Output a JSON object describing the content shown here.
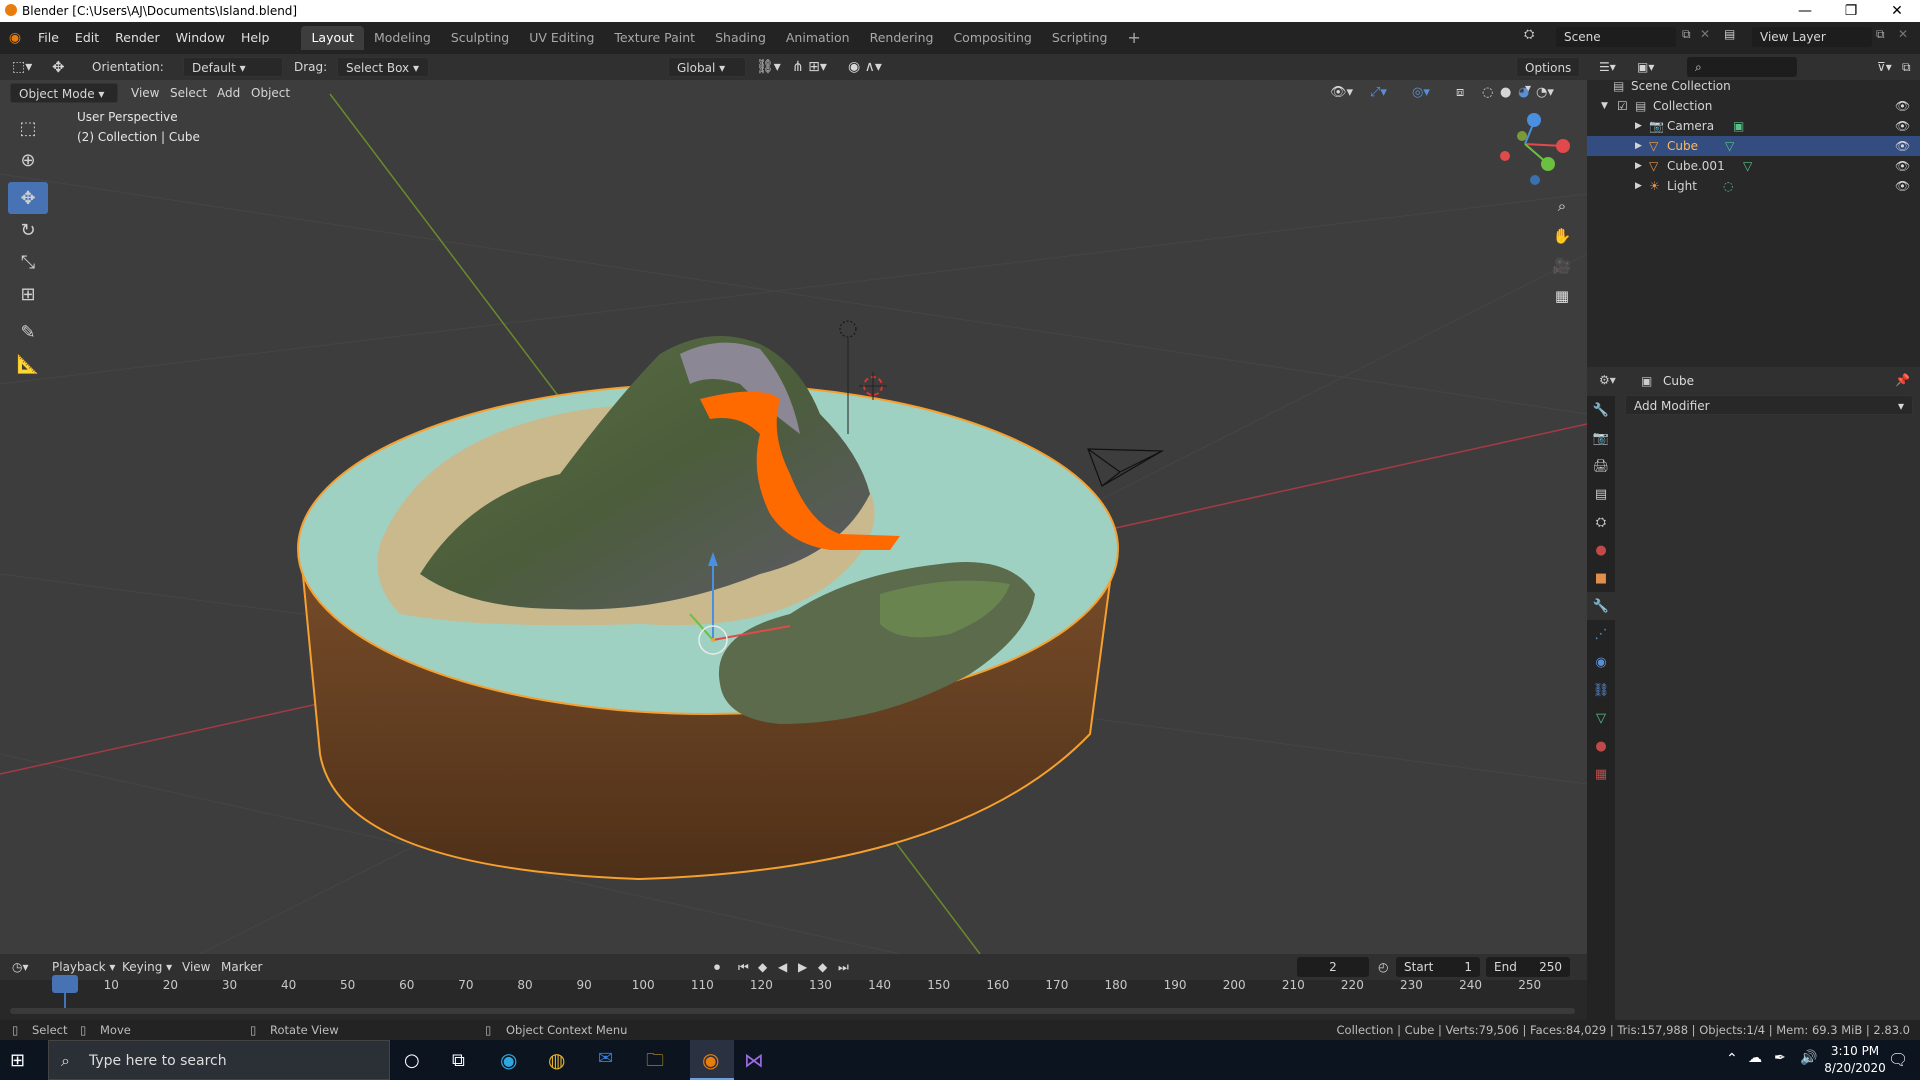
{
  "window": {
    "title": "Blender [C:\\Users\\AJ\\Documents\\Island.blend]"
  },
  "menus": [
    "File",
    "Edit",
    "Render",
    "Window",
    "Help"
  ],
  "workspaces": [
    "Layout",
    "Modeling",
    "Sculpting",
    "UV Editing",
    "Texture Paint",
    "Shading",
    "Animation",
    "Rendering",
    "Compositing",
    "Scripting"
  ],
  "active_workspace": "Layout",
  "scene": {
    "name": "Scene",
    "view_layer": "View Layer"
  },
  "tool_header": {
    "orientation_label": "Orientation:",
    "orientation_value": "Default",
    "drag_label": "Drag:",
    "drag_value": "Select Box",
    "transform_orientation": "Global",
    "options_label": "Options"
  },
  "viewport_header": {
    "mode": "Object Mode",
    "menu": [
      "View",
      "Select",
      "Add",
      "Object"
    ]
  },
  "viewport_overlay": {
    "perspective": "User Perspective",
    "collection_info": "(2) Collection | Cube"
  },
  "outliner": {
    "root": "Scene Collection",
    "collection": "Collection",
    "items": [
      {
        "name": "Camera",
        "selected": false
      },
      {
        "name": "Cube",
        "selected": true
      },
      {
        "name": "Cube.001",
        "selected": false
      },
      {
        "name": "Light",
        "selected": false
      }
    ]
  },
  "properties": {
    "object_name": "Cube",
    "add_modifier_label": "Add Modifier"
  },
  "timeline": {
    "menu": [
      "Playback",
      "Keying",
      "View",
      "Marker"
    ],
    "current_frame": "2",
    "start_label": "Start",
    "start_value": "1",
    "end_label": "End",
    "end_value": "250",
    "ticks": [
      "2",
      "10",
      "20",
      "30",
      "40",
      "50",
      "60",
      "70",
      "80",
      "90",
      "100",
      "110",
      "120",
      "130",
      "140",
      "150",
      "160",
      "170",
      "180",
      "190",
      "200",
      "210",
      "220",
      "230",
      "240",
      "250"
    ]
  },
  "statusbar": {
    "select": "Select",
    "move": "Move",
    "rotate": "Rotate View",
    "context_menu": "Object Context Menu",
    "stats": "Collection | Cube | Verts:79,506 | Faces:84,029 | Tris:157,988 | Objects:1/4 | Mem: 69.3 MiB | 2.83.0"
  },
  "taskbar": {
    "search_placeholder": "Type here to search",
    "time": "3:10 PM",
    "date": "8/20/2020"
  },
  "colors": {
    "accent": "#4772b3",
    "selection_outline": "#f5a030",
    "lava": "#ff6a00",
    "water": "#9fd1c2"
  }
}
